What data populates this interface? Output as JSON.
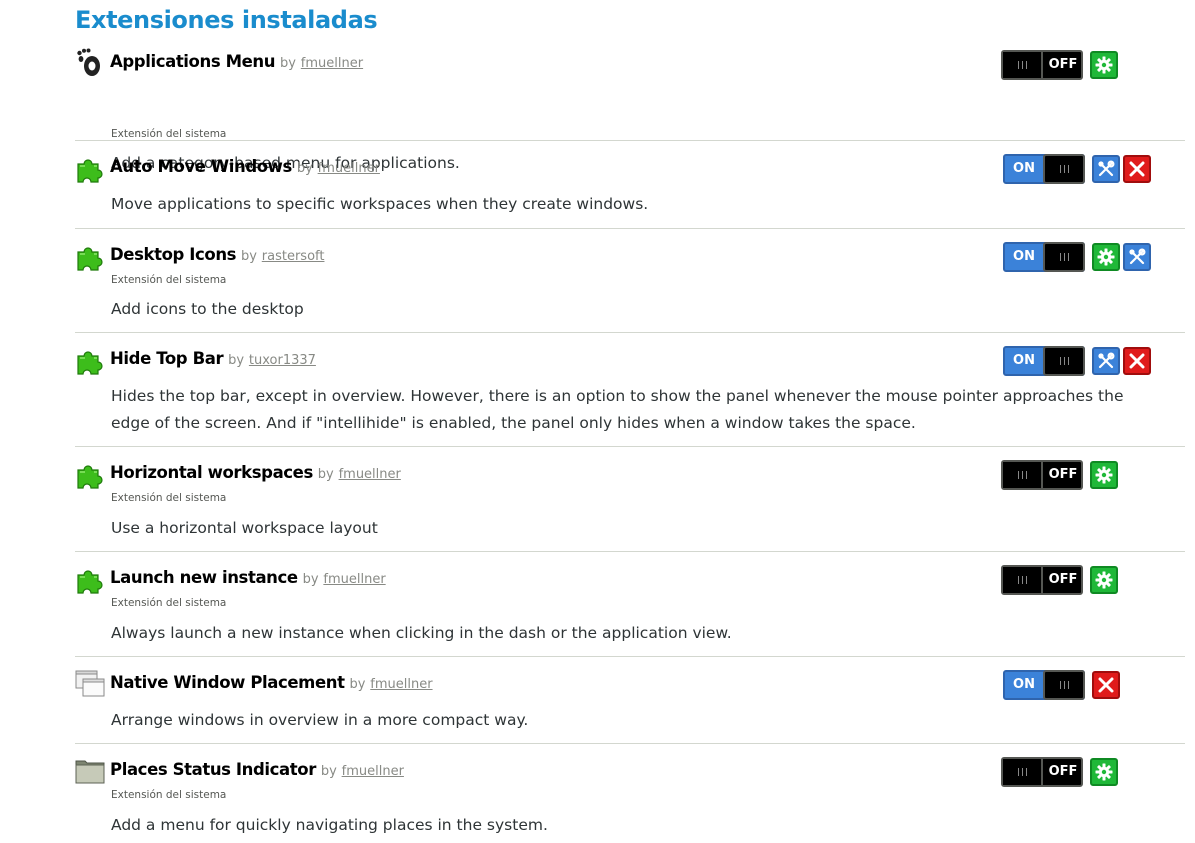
{
  "page_title": "Extensiones instaladas",
  "colors": {
    "heading": "#1a8ccd",
    "switch_on": "#3b82d9",
    "prefs_button": "#1fb838",
    "remove_button": "#e01b1b"
  },
  "extensions": [
    {
      "icon": "gnome-foot-icon",
      "name": "Applications Menu",
      "by": "by",
      "author": "fmuellner",
      "system_label": "Extensión del sistema",
      "state_label": "OFF",
      "enabled": false,
      "description": "Add a category-based menu for applications.",
      "buttons": [
        "preferences"
      ]
    },
    {
      "icon": "puzzle-piece-icon",
      "name": "Auto Move Windows",
      "by": "by",
      "author": "fmuellner",
      "system_label": "",
      "state_label": "ON",
      "enabled": true,
      "description": "Move applications to specific workspaces when they create windows.",
      "buttons": [
        "tools",
        "remove"
      ]
    },
    {
      "icon": "puzzle-piece-icon",
      "name": "Desktop Icons",
      "by": "by",
      "author": "rastersoft",
      "system_label": "Extensión del sistema",
      "state_label": "ON",
      "enabled": true,
      "description": "Add icons to the desktop",
      "buttons": [
        "preferences",
        "tools"
      ]
    },
    {
      "icon": "puzzle-piece-icon",
      "name": "Hide Top Bar",
      "by": "by",
      "author": "tuxor1337",
      "system_label": "",
      "state_label": "ON",
      "enabled": true,
      "description": "Hides the top bar, except in overview. However, there is an option to show the panel whenever the mouse pointer approaches the edge of the screen. And if \"intellihide\" is enabled, the panel only hides when a window takes the space.",
      "buttons": [
        "tools",
        "remove"
      ]
    },
    {
      "icon": "puzzle-piece-icon",
      "name": "Horizontal workspaces",
      "by": "by",
      "author": "fmuellner",
      "system_label": "Extensión del sistema",
      "state_label": "OFF",
      "enabled": false,
      "description": "Use a horizontal workspace layout",
      "buttons": [
        "preferences"
      ]
    },
    {
      "icon": "puzzle-piece-icon",
      "name": "Launch new instance",
      "by": "by",
      "author": "fmuellner",
      "system_label": "Extensión del sistema",
      "state_label": "OFF",
      "enabled": false,
      "description": "Always launch a new instance when clicking in the dash or the application view.",
      "buttons": [
        "preferences"
      ]
    },
    {
      "icon": "windows-icon",
      "name": "Native Window Placement",
      "by": "by",
      "author": "fmuellner",
      "system_label": "",
      "state_label": "ON",
      "enabled": true,
      "description": "Arrange windows in overview in a more compact way.",
      "buttons": [
        "remove"
      ]
    },
    {
      "icon": "folder-icon",
      "name": "Places Status Indicator",
      "by": "by",
      "author": "fmuellner",
      "system_label": "Extensión del sistema",
      "state_label": "OFF",
      "enabled": false,
      "description": "Add a menu for quickly navigating places in the system.",
      "buttons": [
        "preferences"
      ]
    }
  ]
}
